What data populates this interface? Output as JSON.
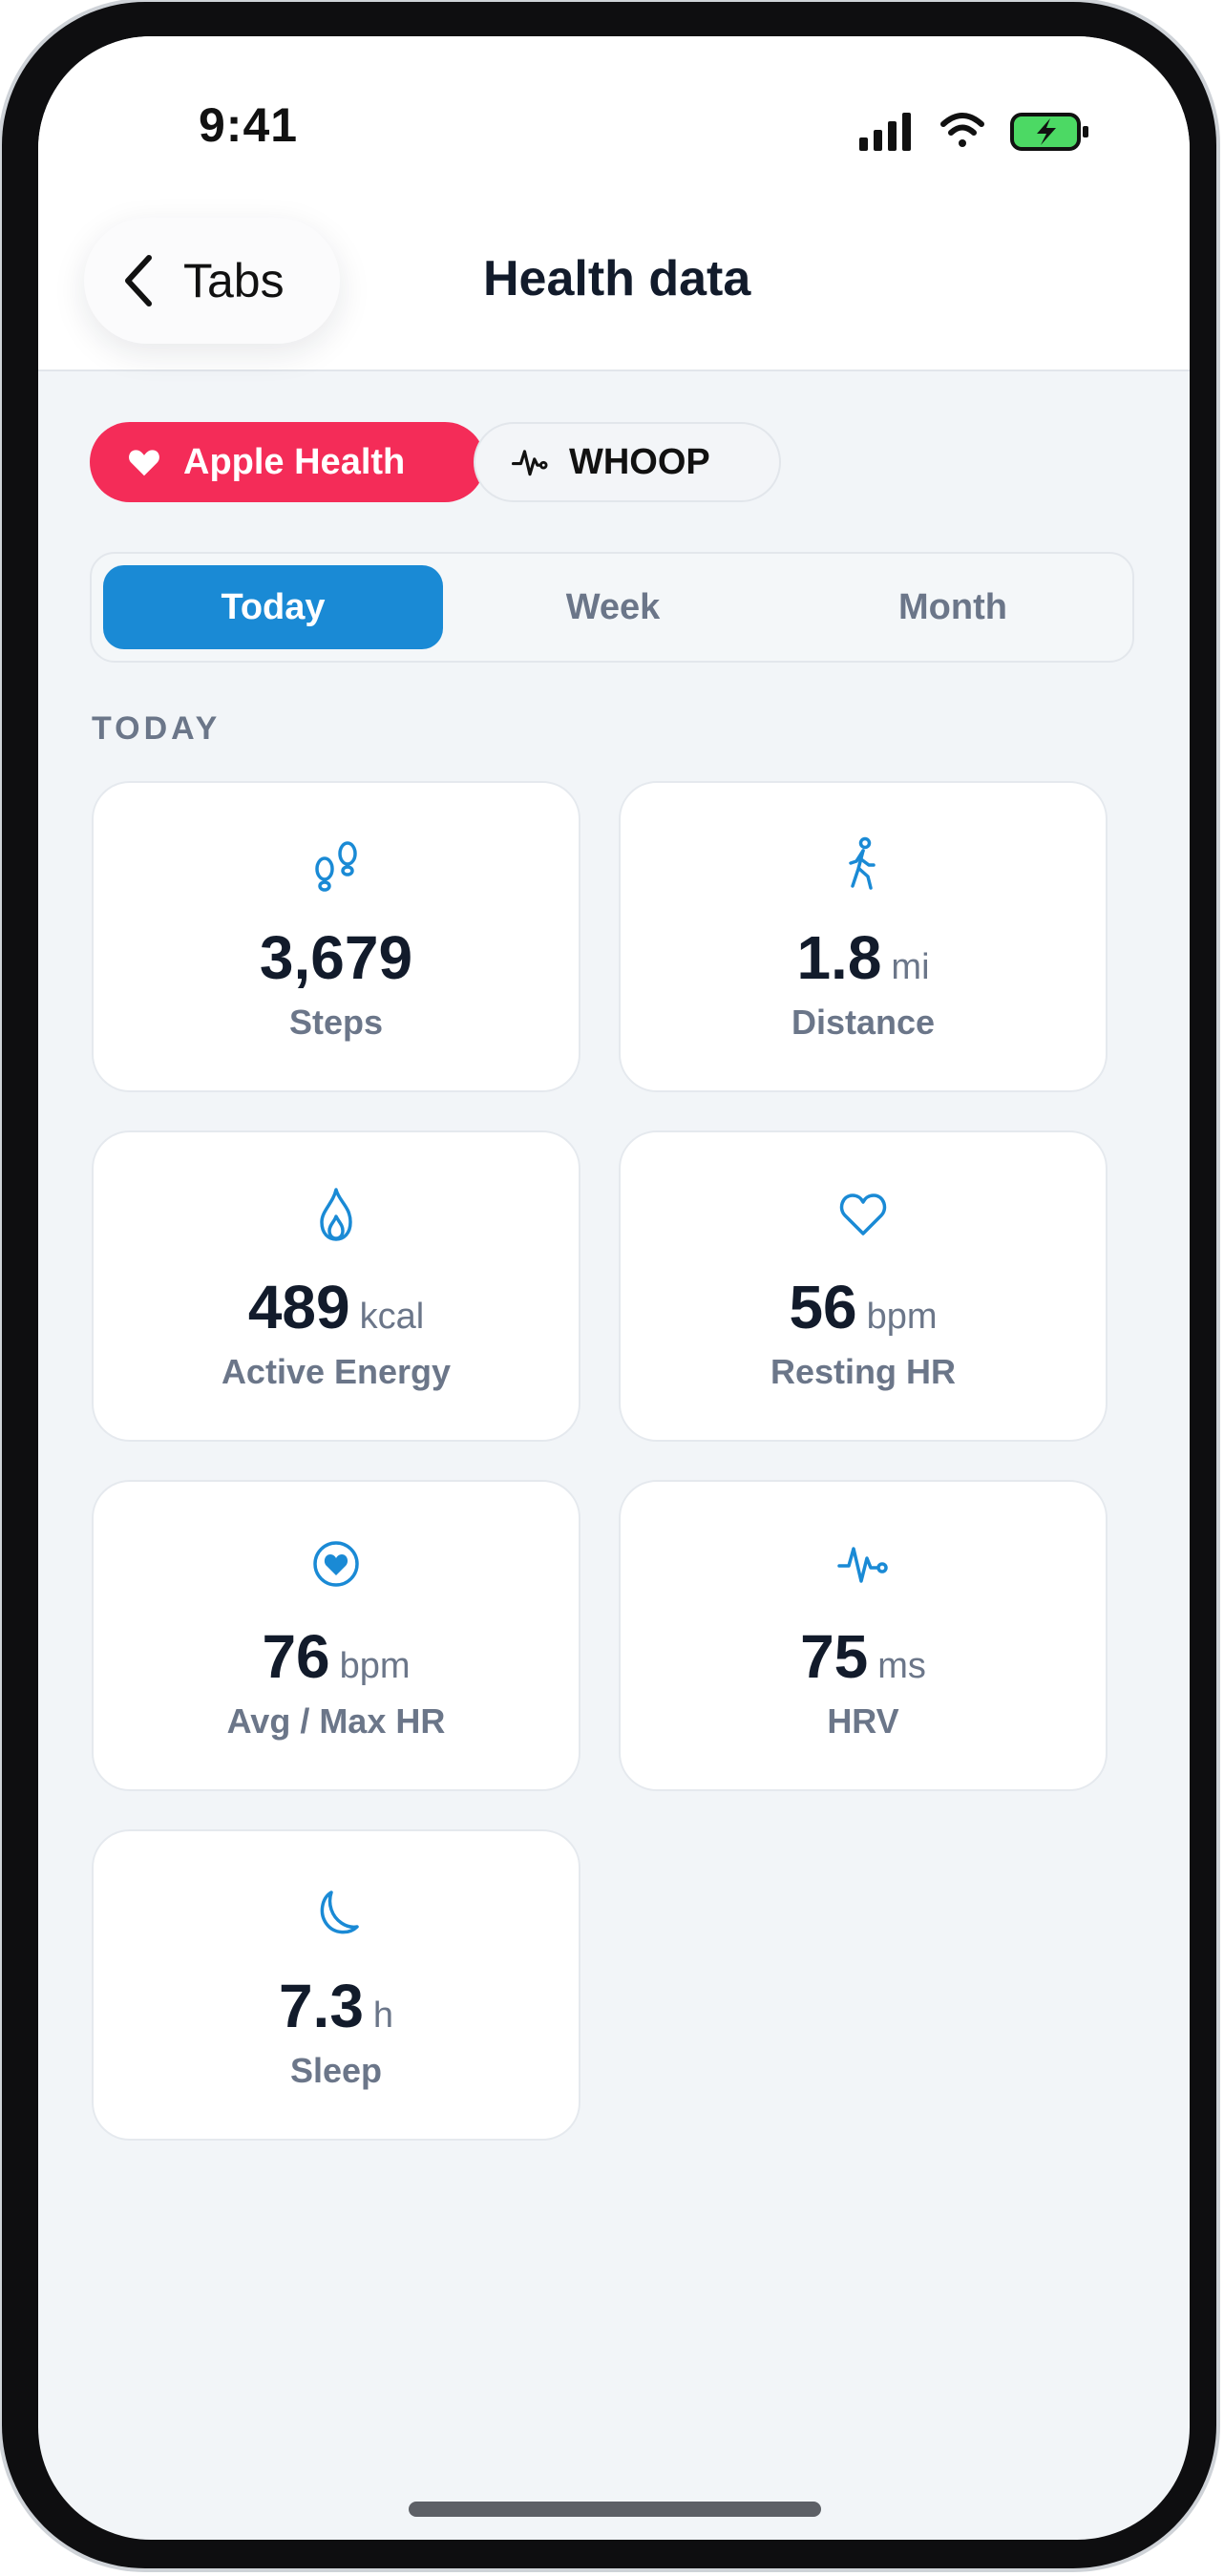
{
  "status_bar": {
    "time": "9:41"
  },
  "nav": {
    "back_label": "Tabs",
    "title": "Health data"
  },
  "sources": [
    {
      "label": "Apple Health",
      "icon": "heart-icon",
      "active": true
    },
    {
      "label": "WHOOP",
      "icon": "pulse-icon",
      "active": false
    }
  ],
  "periods": [
    {
      "label": "Today",
      "active": true
    },
    {
      "label": "Week",
      "active": false
    },
    {
      "label": "Month",
      "active": false
    }
  ],
  "section_label": "TODAY",
  "metrics": [
    {
      "icon": "footprints-icon",
      "value": "3,679",
      "unit": "",
      "label": "Steps"
    },
    {
      "icon": "walking-icon",
      "value": "1.8",
      "unit": "mi",
      "label": "Distance"
    },
    {
      "icon": "flame-icon",
      "value": "489",
      "unit": "kcal",
      "label": "Active Energy"
    },
    {
      "icon": "heart-outline-icon",
      "value": "56",
      "unit": "bpm",
      "label": "Resting HR"
    },
    {
      "icon": "heart-circle-icon",
      "value": "76",
      "unit": "bpm",
      "label": "Avg / Max HR"
    },
    {
      "icon": "pulse-icon",
      "value": "75",
      "unit": "ms",
      "label": "HRV"
    },
    {
      "icon": "moon-icon",
      "value": "7.3",
      "unit": "h",
      "label": "Sleep"
    }
  ],
  "colors": {
    "accent": "#1a8ad5",
    "apple_health": "#f42c58",
    "icon": "#1a8ad5"
  }
}
